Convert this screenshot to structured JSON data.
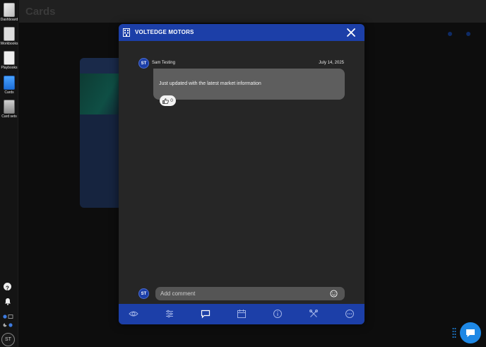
{
  "background": {
    "page_title": "Cards"
  },
  "rail": {
    "items": [
      {
        "label": "Dashboard"
      },
      {
        "label": "Workbooks"
      },
      {
        "label": "Playbooks"
      },
      {
        "label": "Cards"
      },
      {
        "label": "Card sets"
      }
    ],
    "user_initials": "ST"
  },
  "modal": {
    "title": "VOLTEDGE MOTORS",
    "message": {
      "author_initials": "ST",
      "author": "Sam Testing",
      "date": "July 14, 2025",
      "text": "Just updated with the latest market information",
      "like_count": "0"
    },
    "comment": {
      "user_initials": "ST",
      "placeholder": "Add comment"
    },
    "footer_tabs": [
      "eye-icon",
      "sliders-icon",
      "comment-icon",
      "calendar-icon",
      "info-icon",
      "tools-icon",
      "more-icon"
    ]
  },
  "colors": {
    "accent": "#1c3fa8",
    "bubble": "#5e5e5e",
    "chat": "#1e88e5"
  }
}
